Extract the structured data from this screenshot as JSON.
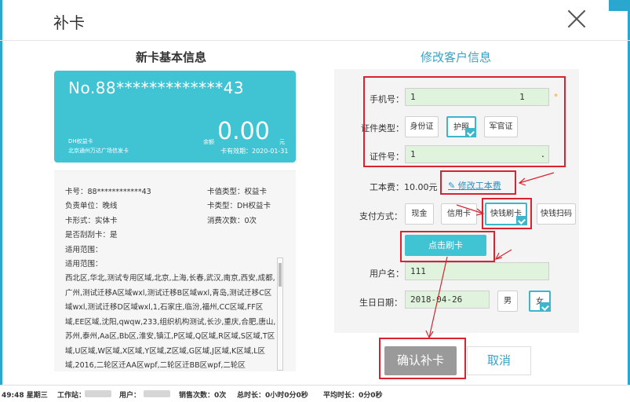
{
  "dialog": {
    "title": "补卡"
  },
  "left": {
    "section_title": "新卡基本信息",
    "card": {
      "number": "No.88*************43",
      "type": "DH权益卡",
      "merchant": "北京通州万达广场信发卡",
      "balance_label": "余额",
      "balance": "0.00",
      "unit": "元",
      "expiry": "卡有效期：2020-01-31"
    },
    "info": {
      "card_no": "卡号：88************43",
      "unit": "负责单位：晚线",
      "card_form": "卡形式：实体卡",
      "scratch": "是否刮刮卡：是",
      "scope1": "适用范围：",
      "scope2": "适用范围：",
      "value_type": "卡值类型：权益卡",
      "card_type": "卡类型：DH权益卡",
      "consume_times": "消费次数：0次",
      "range_text": "西北区,华北,测试专用区域,北京,上海,长春,武汉,南京,西安,成都,广州,测试迁移A区域wxl,测试迁移B区域wxl,青岛,测试迁移C区域wxl,测试迁移D区域wxl,1,石家庄,临汾,福州,CC区域,FF区域,EE区域,沈阳,qwqw,233,组织机构测试,长沙,重庆,合肥,唐山,苏州,泰州,Aa区,Bb区,淮安,镇江,P区域,Q区域,R区域,S区域,T区域,U区域,W区域,X区域,Y区域,Z区域,G区域,J区域,K区域,L区域,2016,二轮区迁AA区wpf,二轮区迁BB区wpf,二轮区"
    }
  },
  "right": {
    "section_title": "修改客户信息",
    "phone_label": "手机号：",
    "phone_value": "1                    1",
    "required_mark": "*",
    "id_type_label": "证件类型：",
    "id_types": [
      "身份证",
      "护照",
      "军官证"
    ],
    "id_no_label": "证件号：",
    "id_no_value": "1                        .4",
    "fee_label": "工本费：10.00元",
    "fee_link": "修改工本费",
    "pay_label": "支付方式：",
    "pay_methods": [
      "现金",
      "信用卡",
      "快钱刷卡",
      "快钱扫码"
    ],
    "swipe_button": "点击刷卡",
    "username_label": "用户名：",
    "username_value": "111",
    "birthday_label": "生日日期：",
    "birthday_value": "2018-04-26",
    "gender_male": "男",
    "gender_female": "女"
  },
  "footer": {
    "confirm": "确认补卡",
    "cancel": "取消"
  },
  "status_bar": {
    "time": "49:48 星期三",
    "station_label": "工作站：",
    "user_label": "用户：",
    "sales_count": "销售次数：0次",
    "total_time": "总时长：0小时0分0秒",
    "avg_time": "平均时长：0分0秒"
  },
  "colors": {
    "accent": "#40c4d4",
    "highlight": "#d9232f",
    "link": "#2a8fc0",
    "input_filled": "#dff3dd"
  }
}
